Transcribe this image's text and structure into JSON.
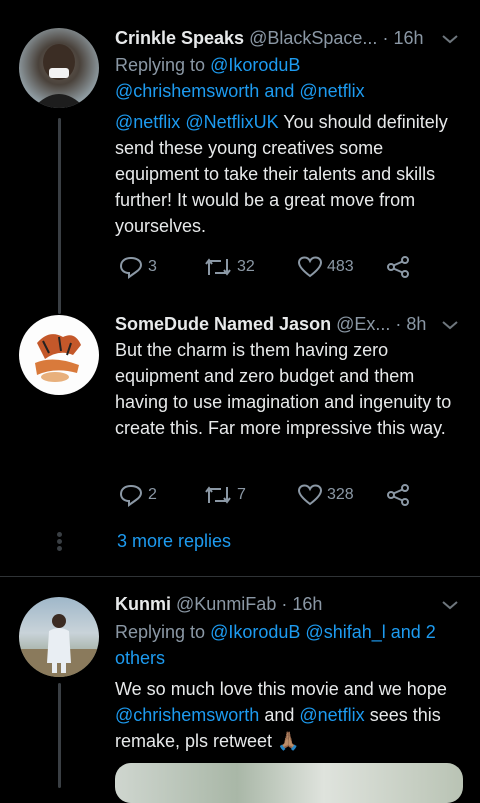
{
  "tweets": [
    {
      "name": "Crinkle Speaks",
      "handle": "@BlackSpace...",
      "time": "· 16h",
      "replying_prefix": "Replying to",
      "replying_line1_link": "@IkoroduB",
      "replying_line2_link1": "@chrishemsworth",
      "replying_line2_and": "and",
      "replying_line2_link2": "@netflix",
      "body_mention1": "@netflix",
      "body_mention2": "@NetflixUK",
      "body_text1": " You should",
      "body_text2": "definitely send these young creatives some equipment to take their talents and skills further! It would be a great move from yourselves.",
      "replies": "3",
      "retweets": "32",
      "likes": "483"
    },
    {
      "name": "SomeDude Named Jason",
      "handle": "@Ex...",
      "time": "· 8h",
      "body_text": "But the charm is them having zero equipment and zero budget and them having to use imagination and ingenuity to create this. Far more impressive this way.",
      "replies": "2",
      "retweets": "7",
      "likes": "328"
    },
    {
      "name": "Kunmi",
      "handle": "@KunmiFab",
      "time": "· 16h",
      "replying_prefix": "Replying to",
      "replying_link1": "@IkoroduB",
      "replying_link2": "@shifah_l",
      "replying_and": "and 2",
      "replying_others": "others",
      "body_text1": "We so much love this movie and we hope",
      "body_mention1": "@chrishemsworth",
      "body_and": "and",
      "body_mention2": "@netflix",
      "body_text2": "sees this remake, pls retweet",
      "emoji": "🙏🏽"
    }
  ],
  "more_replies": "3 more replies",
  "icons": {
    "reply": "reply-icon",
    "retweet": "retweet-icon",
    "like": "heart-icon",
    "share": "share-icon",
    "menu": "chevron-down-icon"
  },
  "colors": {
    "link": "#1d9bf0",
    "muted": "#8b98a5",
    "text": "#e7e9ea",
    "bg": "#000000"
  }
}
